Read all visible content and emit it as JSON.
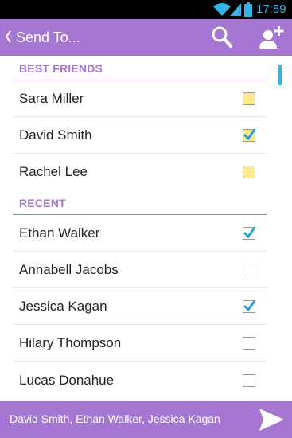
{
  "status_bar": {
    "time": "17:59",
    "icons": [
      "wifi-icon",
      "signal-icon",
      "battery-icon"
    ],
    "accent_color": "#33b5e5"
  },
  "action_bar": {
    "title": "Send To...",
    "icons": [
      "back-chevron-icon",
      "search-icon",
      "add-friend-icon"
    ],
    "background_color": "#a576d2"
  },
  "sections": [
    {
      "header": "BEST FRIENDS",
      "contacts": [
        {
          "name": "Sara Miller",
          "selected": false,
          "checkbox_style": "best-friend"
        },
        {
          "name": "David Smith",
          "selected": true,
          "checkbox_style": "best-friend"
        },
        {
          "name": "Rachel Lee",
          "selected": false,
          "checkbox_style": "best-friend"
        }
      ]
    },
    {
      "header": "RECENT",
      "contacts": [
        {
          "name": "Ethan Walker",
          "selected": true,
          "checkbox_style": "standard"
        },
        {
          "name": "Annabell Jacobs",
          "selected": false,
          "checkbox_style": "standard"
        },
        {
          "name": "Jessica Kagan",
          "selected": true,
          "checkbox_style": "standard"
        },
        {
          "name": "Hilary Thompson",
          "selected": false,
          "checkbox_style": "standard"
        },
        {
          "name": "Lucas Donahue",
          "selected": false,
          "checkbox_style": "standard"
        }
      ]
    }
  ],
  "bottom_bar": {
    "recipients": "David Smith, Ethan Walker, Jessica Kagan",
    "send_icon": "send-icon"
  },
  "colors": {
    "brand_purple": "#a576d2",
    "check_blue": "#2a9fd6",
    "best_friend_box": "#ffe98a"
  }
}
